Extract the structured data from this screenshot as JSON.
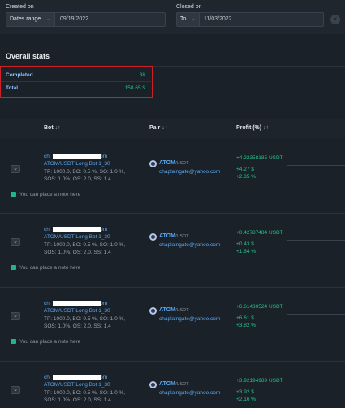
{
  "filters": {
    "created_label": "Created on",
    "created_mode": "Dates range",
    "created_value": "09/19/2022",
    "closed_label": "Closed on",
    "closed_mode": "To",
    "closed_value": "11/03/2022",
    "clear_icon": "close-icon"
  },
  "stats": {
    "title": "Overall stats",
    "completed_label": "Completed",
    "completed_value": "38",
    "total_label": "Total",
    "total_value": "158.65 $"
  },
  "table": {
    "headers": {
      "bot": "Bot",
      "pair": "Pair",
      "profit": "Profit (%)",
      "sort_glyph": "↓↑"
    },
    "rows": [
      {
        "email_prefix": "ch",
        "email_suffix": "com",
        "bot_name": "ATOM/USDT Long Bot 1_30",
        "info_line1": "TP: 1000.0, BO: 0.5 %, SO: 1.0 %,",
        "info_line2": "SOS: 1.0%, OS: 2.0, SS: 1.4",
        "pair_base": "ATOM",
        "pair_quote": "/USDT",
        "account": "chaplaingate@yahoo.com",
        "profit_main": "+4.22358185 USDT",
        "profit_usd": "+4.27 $",
        "profit_pct": "+2.35 %",
        "note": "You can place a note here"
      },
      {
        "email_prefix": "ch",
        "email_suffix": "com",
        "bot_name": "ATOM/USDT Long Bot 1_30",
        "info_line1": "TP: 1000.0, BO: 0.5 %, SO: 1.0 %,",
        "info_line2": "SOS: 1.0%, OS: 2.0, SS: 1.4",
        "pair_base": "ATOM",
        "pair_quote": "/USDT",
        "account": "chaplaingate@yahoo.com",
        "profit_main": "+0.42787484 USDT",
        "profit_usd": "+0.43 $",
        "profit_pct": "+1.64 %",
        "note": "You can place a note here"
      },
      {
        "email_prefix": "ch",
        "email_suffix": "com",
        "bot_name": "ATOM/USDT Long Bot 1_30",
        "info_line1": "TP: 1000.0, BO: 0.5 %, SO: 1.0 %,",
        "info_line2": "SOS: 1.0%, OS: 2.0, SS: 1.4",
        "pair_base": "ATOM",
        "pair_quote": "/USDT",
        "account": "chaplaingate@yahoo.com",
        "profit_main": "+6.61430524 USDT",
        "profit_usd": "+6.61 $",
        "profit_pct": "+3.82 %",
        "note": "You can place a note here"
      },
      {
        "email_prefix": "ch",
        "email_suffix": "com",
        "bot_name": "ATOM/USDT Long Bot 1_30",
        "info_line1": "TP: 1000.0, BO: 0.5 %, SO: 1.0 %,",
        "info_line2": "SOS: 1.0%, OS: 2.0, SS: 1.4",
        "pair_base": "ATOM",
        "pair_quote": "/USDT",
        "account": "chaplaingate@yahoo.com",
        "profit_main": "+3.92194989 USDT",
        "profit_usd": "+3.92 $",
        "profit_pct": "+2.16 %",
        "note": ""
      }
    ]
  },
  "colors": {
    "background": "#1b2129",
    "accent_blue": "#5aa8f0",
    "profit_green": "#25c28b",
    "highlight_red": "#d11f28"
  }
}
